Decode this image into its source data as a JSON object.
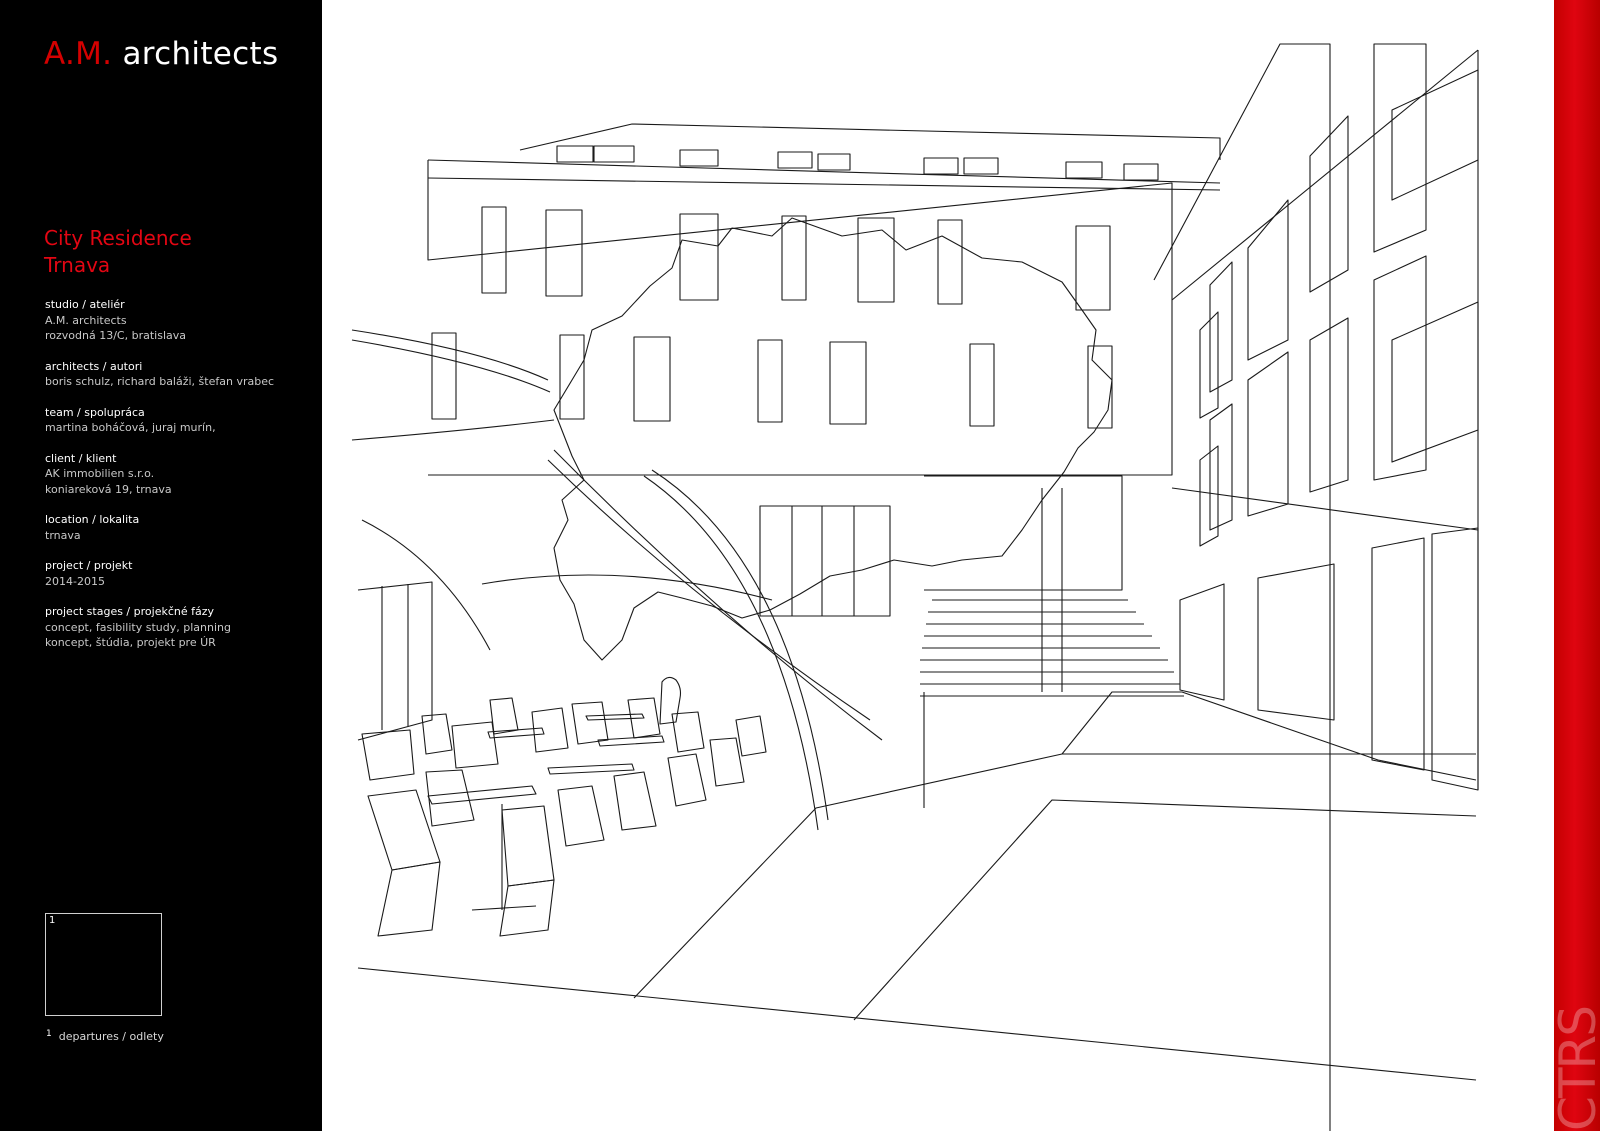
{
  "brand": {
    "accent": "A.M.",
    "name": "architects"
  },
  "project": {
    "title_line1": "City Residence",
    "title_line2": "Trnava"
  },
  "info": [
    {
      "label": "studio / ateliér",
      "lines": [
        "A.M. architects",
        "rozvodná 13/C, bratislava"
      ]
    },
    {
      "label": "architects / autori",
      "lines": [
        "boris schulz, richard baláži, štefan vrabec"
      ]
    },
    {
      "label": "team / spolupráca",
      "lines": [
        "martina boháčová, juraj murín,"
      ]
    },
    {
      "label": "client / klient",
      "lines": [
        "AK immobilien s.r.o.",
        "koniareková 19, trnava"
      ]
    },
    {
      "label": "location / lokalita",
      "lines": [
        "trnava"
      ]
    },
    {
      "label": "project / projekt",
      "lines": [
        "2014-2015"
      ]
    },
    {
      "label": "project stages / projekčné fázy",
      "lines": [
        "concept, fasibility study, planning",
        "koncept, štúdia, projekt pre ÚR"
      ]
    }
  ],
  "key": {
    "number": "1"
  },
  "legend": {
    "number": "1",
    "label": "departures / odlety"
  },
  "side_label": "CTRS",
  "colors": {
    "accent": "#e30613",
    "sidebar": "#000000",
    "redbar": "#d40000",
    "line": "#1a1a1a"
  }
}
